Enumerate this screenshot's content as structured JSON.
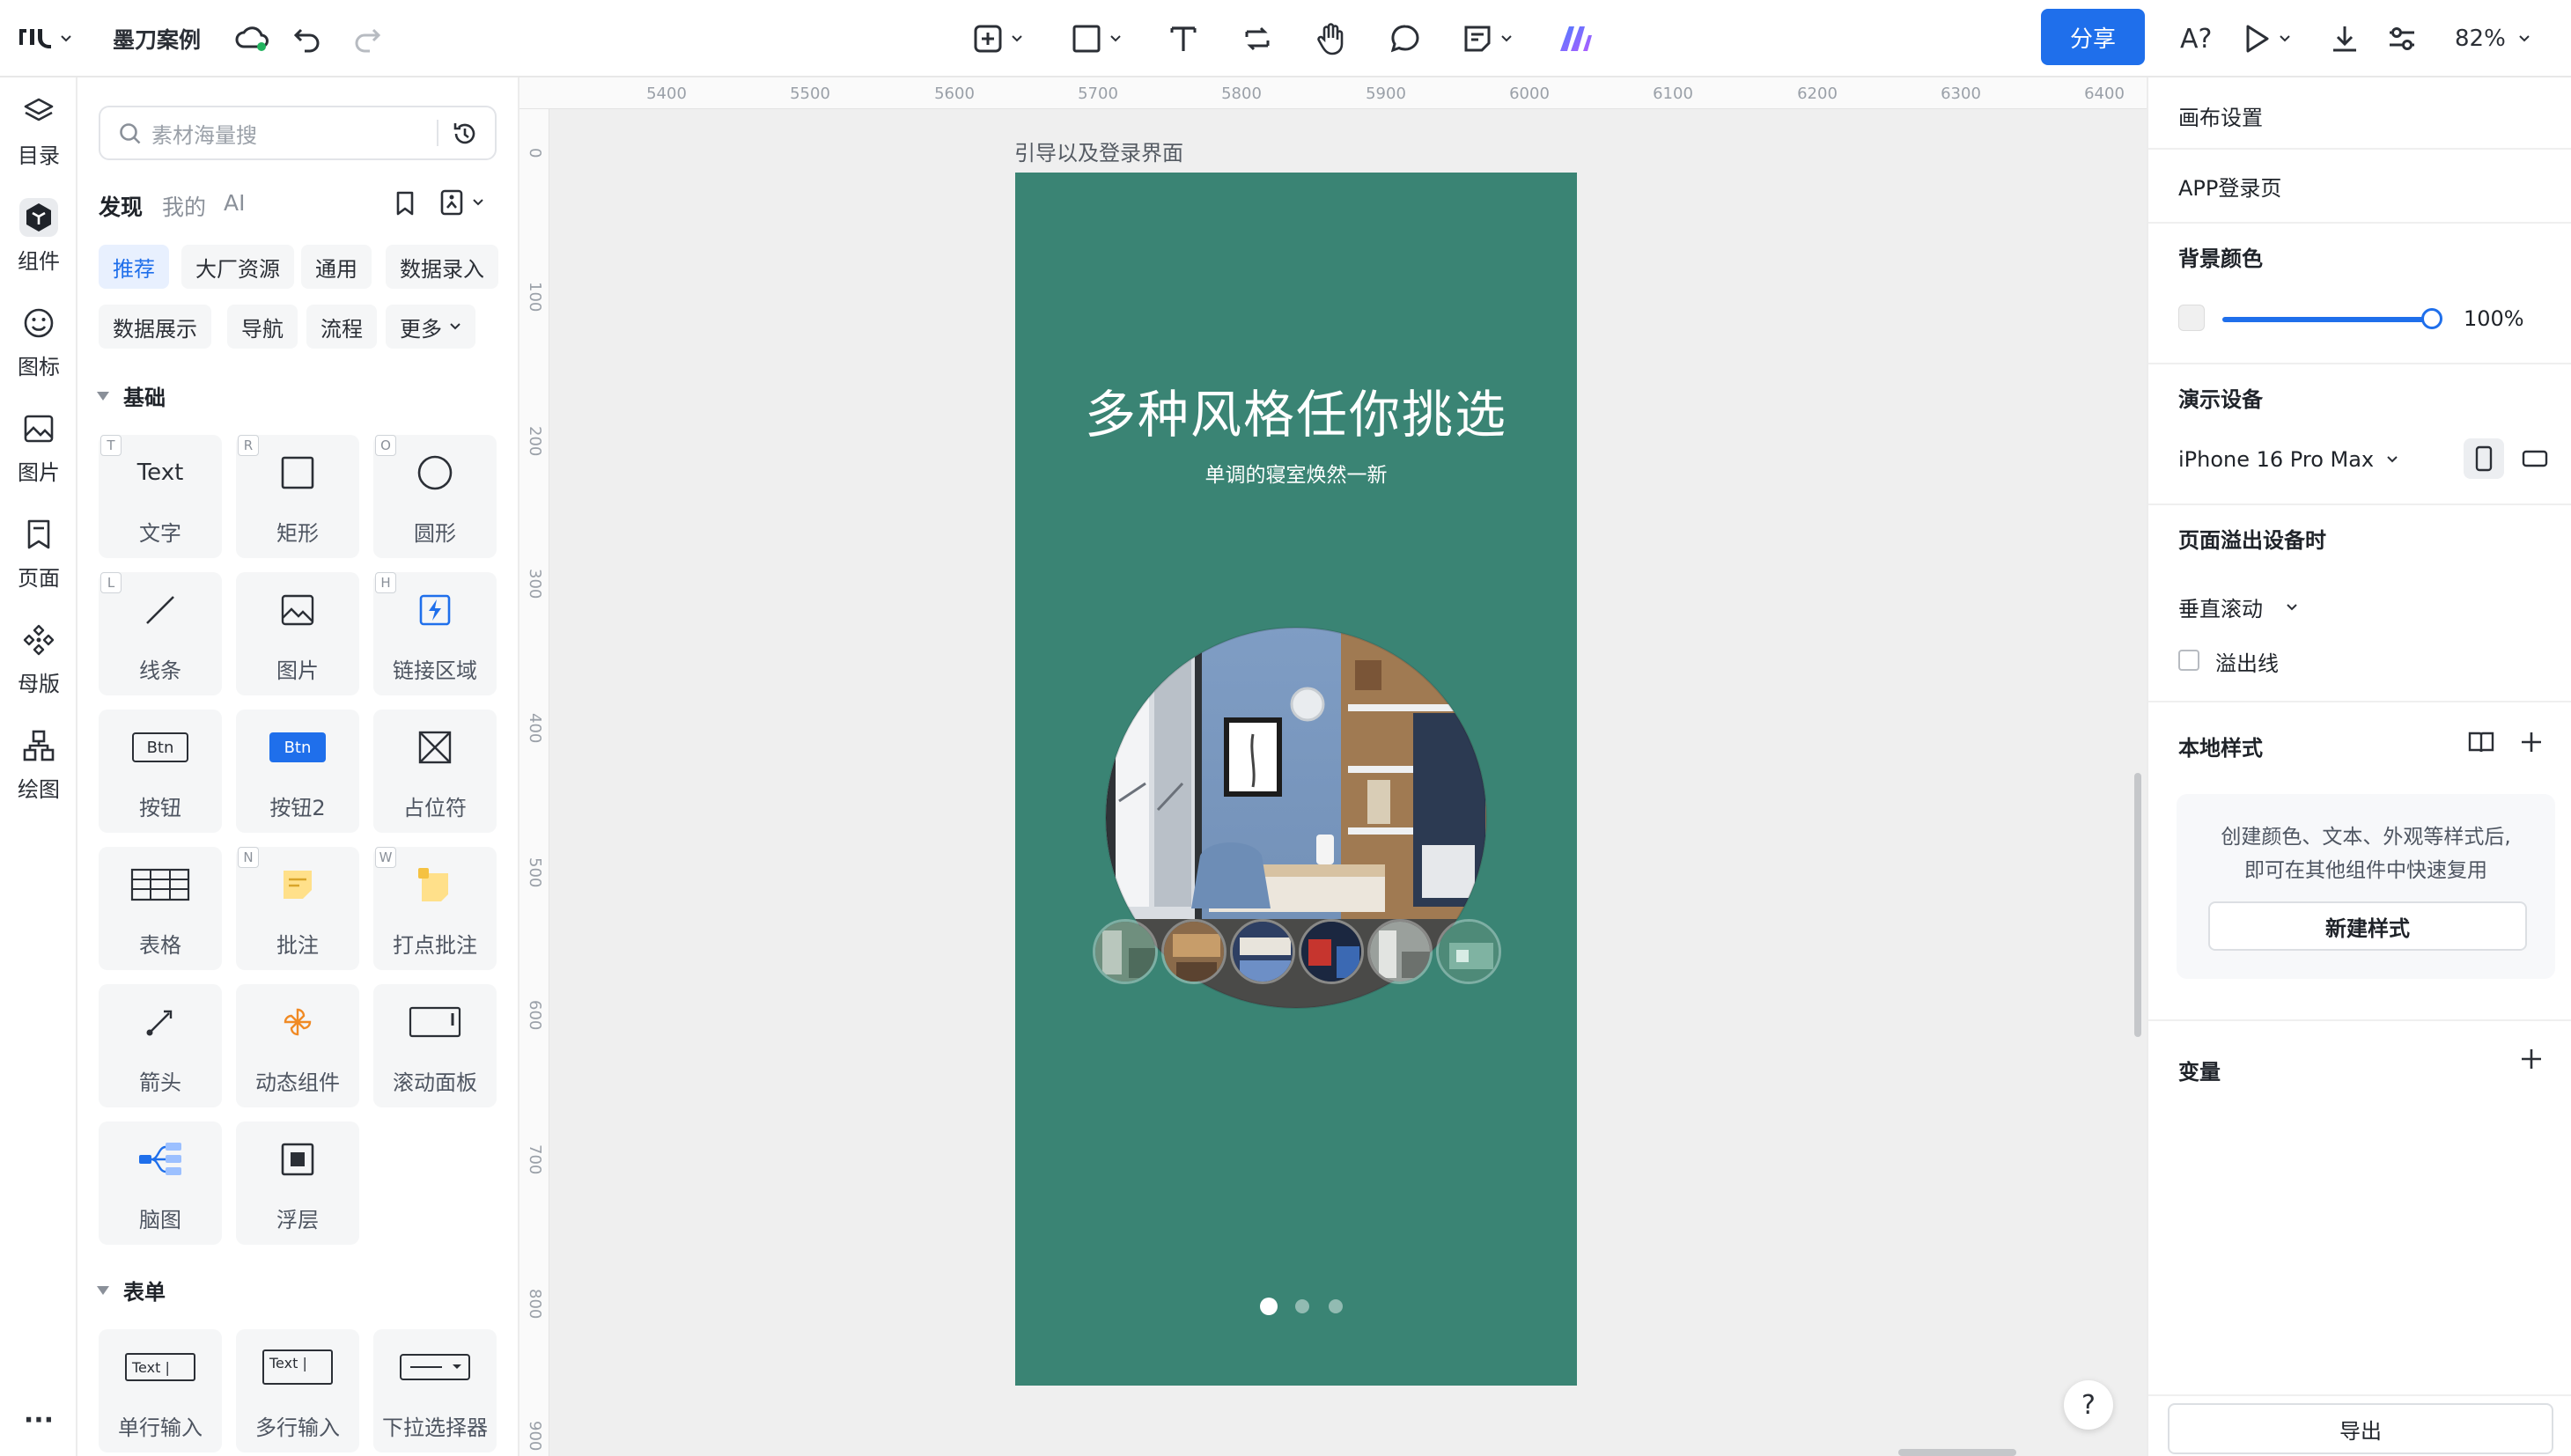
{
  "header": {
    "project_name": "墨刀案例",
    "share_label": "分享",
    "zoom": "82%",
    "font_tool_label": "A?"
  },
  "rail": {
    "items": [
      {
        "label": "目录",
        "icon": "layers-icon"
      },
      {
        "label": "组件",
        "icon": "component-icon"
      },
      {
        "label": "图标",
        "icon": "smiley-icon"
      },
      {
        "label": "图片",
        "icon": "image-icon"
      },
      {
        "label": "页面",
        "icon": "page-icon"
      },
      {
        "label": "母版",
        "icon": "master-icon"
      },
      {
        "label": "绘图",
        "icon": "draw-icon"
      }
    ],
    "more": "···"
  },
  "panel": {
    "search_placeholder": "素材海量搜",
    "tabs": [
      "发现",
      "我的",
      "AI"
    ],
    "chips": [
      "推荐",
      "大厂资源",
      "通用",
      "数据录入",
      "数据展示",
      "导航",
      "流程",
      "更多"
    ],
    "sections": {
      "basic": "基础",
      "form": "表单"
    },
    "tiles": [
      {
        "label": "文字",
        "key": "T",
        "glyph": "Text"
      },
      {
        "label": "矩形",
        "key": "R"
      },
      {
        "label": "圆形",
        "key": "O"
      },
      {
        "label": "线条",
        "key": "L"
      },
      {
        "label": "图片",
        "key": ""
      },
      {
        "label": "链接区域",
        "key": "H"
      },
      {
        "label": "按钮",
        "key": "",
        "glyph": "Btn"
      },
      {
        "label": "按钮2",
        "key": "",
        "glyph": "Btn"
      },
      {
        "label": "占位符",
        "key": ""
      },
      {
        "label": "表格",
        "key": ""
      },
      {
        "label": "批注",
        "key": "N"
      },
      {
        "label": "打点批注",
        "key": "W"
      },
      {
        "label": "箭头",
        "key": ""
      },
      {
        "label": "动态组件",
        "key": ""
      },
      {
        "label": "滚动面板",
        "key": ""
      },
      {
        "label": "脑图",
        "key": ""
      },
      {
        "label": "浮层",
        "key": ""
      }
    ],
    "form_tiles": [
      {
        "label": "单行输入",
        "glyph": "Text |"
      },
      {
        "label": "多行输入",
        "glyph": "Text |"
      },
      {
        "label": "下拉选择器",
        "glyph": ""
      }
    ]
  },
  "canvas": {
    "ruler_h": [
      "5400",
      "5500",
      "5600",
      "5700",
      "5800",
      "5900",
      "6000",
      "6100",
      "6200",
      "6300",
      "6400"
    ],
    "ruler_v": [
      "0",
      "100",
      "200",
      "300",
      "400",
      "500",
      "600",
      "700",
      "800",
      "900"
    ],
    "frame_label": "引导以及登录界面",
    "frame": {
      "title": "多种风格任你挑选",
      "subtitle": "单调的寝室焕然一新",
      "bg_color": "#3a8474",
      "dots_total": 3,
      "dots_active": 1
    },
    "help": "?"
  },
  "inspector": {
    "canvas_settings": "画布设置",
    "page_name": "APP登录页",
    "bg_color_label": "背景颜色",
    "bg_opacity": "100%",
    "device_label": "演示设备",
    "device_value": "iPhone 16 Pro Max",
    "overflow_label": "页面溢出设备时",
    "overflow_value": "垂直滚动",
    "overflow_line_label": "溢出线",
    "local_styles_label": "本地样式",
    "style_tip_line1": "创建颜色、文本、外观等样式后,",
    "style_tip_line2": "即可在其他组件中快速复用",
    "new_style_label": "新建样式",
    "variables_label": "变量",
    "export_label": "导出"
  },
  "colors": {
    "accent": "#1f6feb",
    "frame_bg": "#3a8474",
    "canvas_bg": "#efefef"
  }
}
